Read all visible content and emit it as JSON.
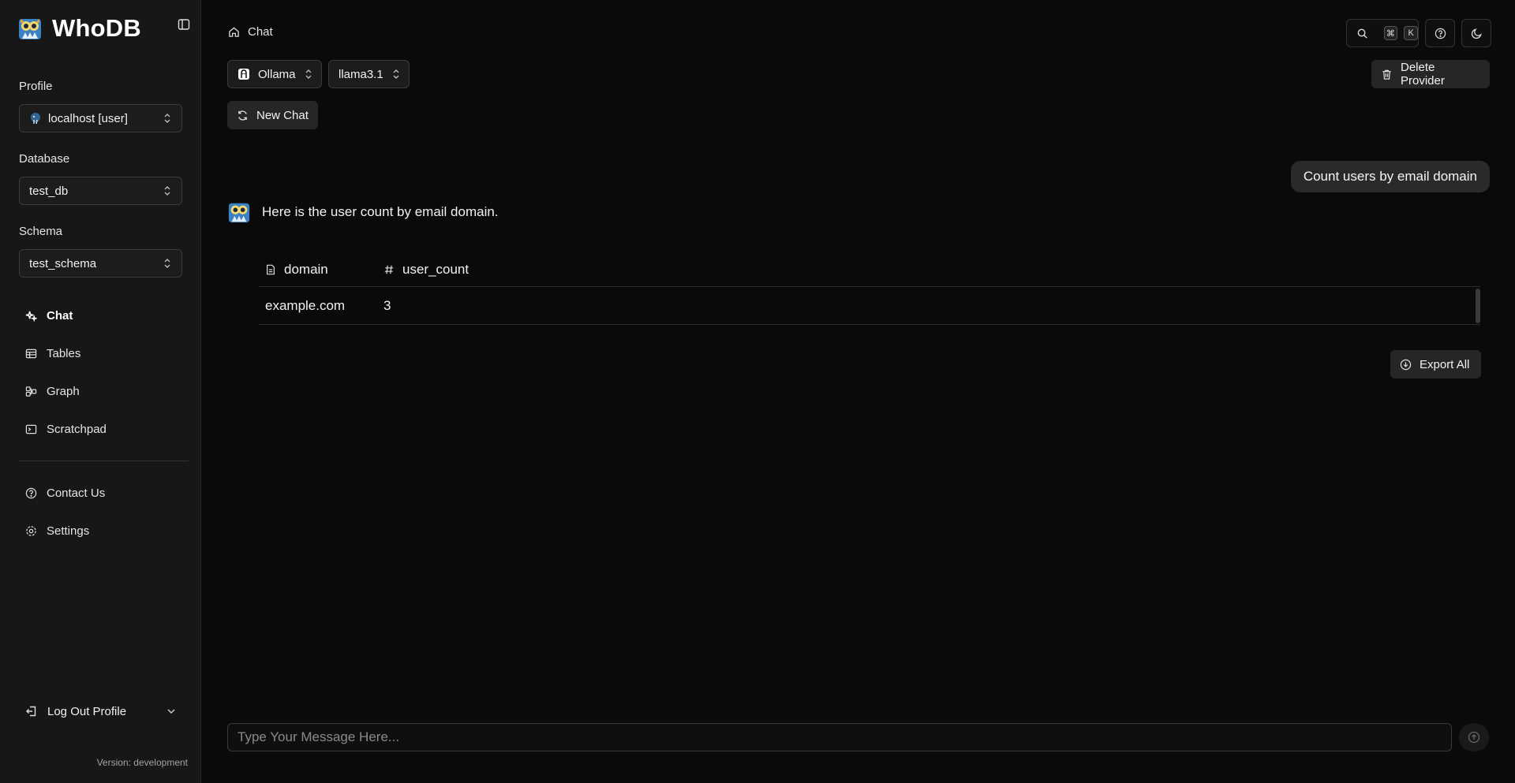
{
  "app": {
    "name": "WhoDB",
    "version": "Version: development"
  },
  "sidebar": {
    "profile_label": "Profile",
    "profile_value": "localhost [user]",
    "database_label": "Database",
    "database_value": "test_db",
    "schema_label": "Schema",
    "schema_value": "test_schema",
    "nav": [
      {
        "label": "Chat",
        "icon": "chat-sparkle-icon",
        "active": true
      },
      {
        "label": "Tables",
        "icon": "table-icon"
      },
      {
        "label": "Graph",
        "icon": "graph-icon"
      },
      {
        "label": "Scratchpad",
        "icon": "terminal-icon"
      }
    ],
    "secondary": [
      {
        "label": "Contact Us",
        "icon": "help-circle-icon"
      },
      {
        "label": "Settings",
        "icon": "gear-icon"
      }
    ],
    "logout_label": "Log Out Profile"
  },
  "header": {
    "breadcrumb": "Chat",
    "kbd": [
      "⌘",
      "K"
    ]
  },
  "toolbar": {
    "provider": "Ollama",
    "model": "llama3.1",
    "delete_provider": "Delete Provider",
    "new_chat": "New Chat"
  },
  "chat": {
    "user_message": "Count users by email domain",
    "bot_message": "Here is the user count by email domain.",
    "table": {
      "columns": [
        {
          "name": "domain",
          "icon": "file-icon"
        },
        {
          "name": "user_count",
          "icon": "hash-icon"
        }
      ],
      "rows": [
        [
          "example.com",
          "3"
        ]
      ]
    },
    "export_label": "Export All"
  },
  "composer": {
    "placeholder": "Type Your Message Here..."
  },
  "colors": {
    "background": "#0a0a0a",
    "sidebar": "#171717",
    "button": "#262626"
  }
}
